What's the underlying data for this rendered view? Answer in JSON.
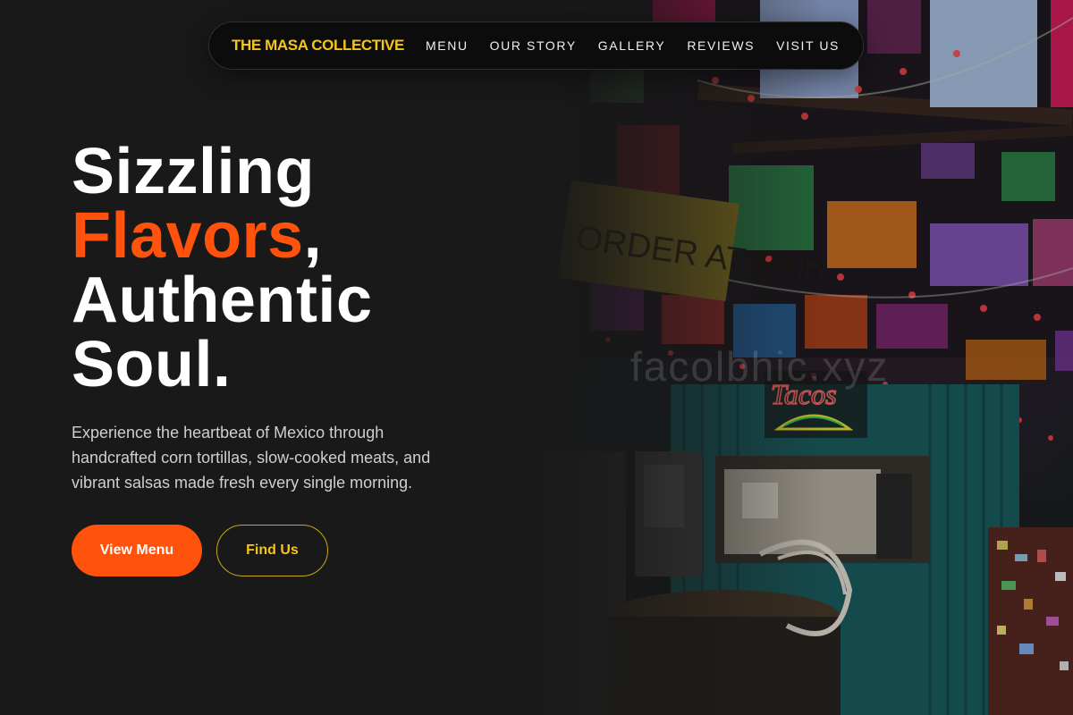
{
  "nav": {
    "brand": "THE MASA COLLECTIVE",
    "links": [
      "MENU",
      "OUR STORY",
      "GALLERY",
      "REVIEWS",
      "VISIT US"
    ]
  },
  "hero": {
    "headline_line1": "Sizzling",
    "headline_accent": "Flavors",
    "headline_comma": ",",
    "headline_line3": "Authentic",
    "headline_line4": "Soul.",
    "lead": "Experience the heartbeat of Mexico through handcrafted corn tortillas, slow-cooked meats, and vibrant salsas made fresh every single morning.",
    "primary_button": "View Menu",
    "secondary_button": "Find Us"
  },
  "background_photo": {
    "sign_text": "ORDER AT BAR",
    "neon_text": "Tacos",
    "watermark": "facolbhic.xyz"
  },
  "colors": {
    "page_bg": "#191919",
    "brand": "#f5c518",
    "accent": "#ff520c",
    "nav_bg": "#0c0c0c",
    "lead_text": "#cfcfcf"
  }
}
